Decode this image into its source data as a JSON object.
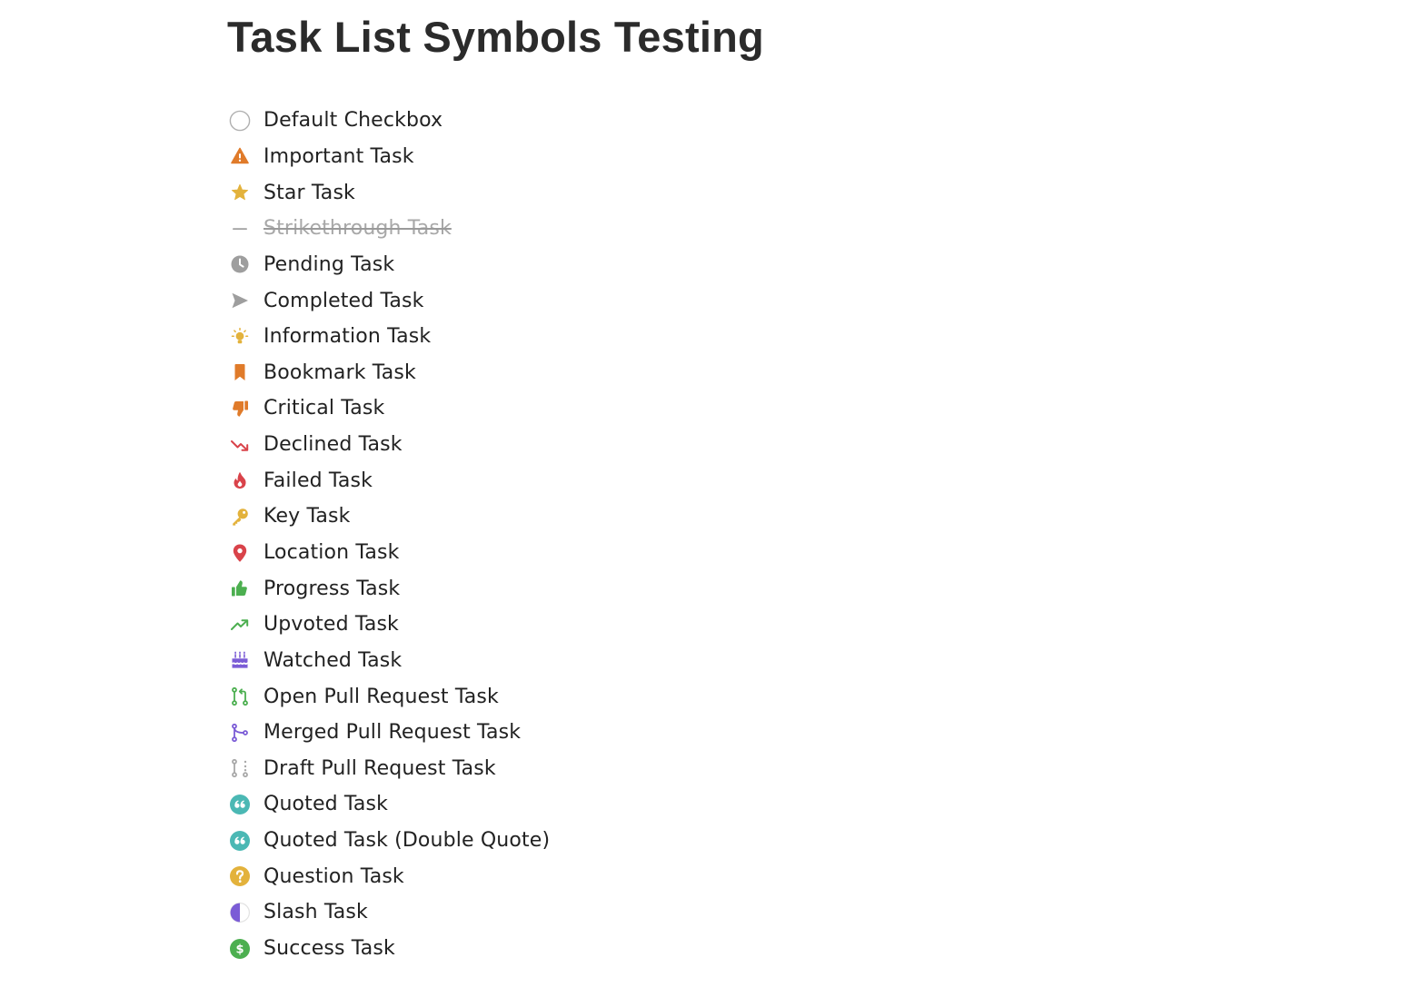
{
  "page": {
    "title": "Task List Symbols Testing"
  },
  "tasks": [
    {
      "label": "Default Checkbox",
      "icon": "empty-checkbox-icon",
      "color": "#b0b0b0"
    },
    {
      "label": "Important Task",
      "icon": "warning-triangle-icon",
      "color": "#e07b2a"
    },
    {
      "label": "Star Task",
      "icon": "star-icon",
      "color": "#e3b23c"
    },
    {
      "label": "Strikethrough Task",
      "icon": "dash-icon",
      "color": "#a0a0a0"
    },
    {
      "label": "Pending Task",
      "icon": "clock-icon",
      "color": "#9e9e9e"
    },
    {
      "label": "Completed Task",
      "icon": "paper-plane-icon",
      "color": "#9e9e9e"
    },
    {
      "label": "Information Task",
      "icon": "lightbulb-icon",
      "color": "#e3b23c"
    },
    {
      "label": "Bookmark Task",
      "icon": "bookmark-icon",
      "color": "#e07b2a"
    },
    {
      "label": "Critical Task",
      "icon": "thumbs-down-icon",
      "color": "#e07b2a"
    },
    {
      "label": "Declined Task",
      "icon": "trending-down-icon",
      "color": "#d9434a"
    },
    {
      "label": "Failed Task",
      "icon": "fire-icon",
      "color": "#d9434a"
    },
    {
      "label": "Key Task",
      "icon": "key-icon",
      "color": "#e3b23c"
    },
    {
      "label": "Location Task",
      "icon": "map-pin-icon",
      "color": "#d9434a"
    },
    {
      "label": "Progress Task",
      "icon": "thumbs-up-icon",
      "color": "#4caf50"
    },
    {
      "label": "Upvoted Task",
      "icon": "trending-up-icon",
      "color": "#4caf50"
    },
    {
      "label": "Watched Task",
      "icon": "cake-icon",
      "color": "#7b5cd6"
    },
    {
      "label": "Open Pull Request Task",
      "icon": "pull-request-icon",
      "color": "#4caf50"
    },
    {
      "label": "Merged Pull Request Task",
      "icon": "merge-icon",
      "color": "#7b5cd6"
    },
    {
      "label": "Draft Pull Request Task",
      "icon": "draft-pull-request-icon",
      "color": "#a8a8a8"
    },
    {
      "label": "Quoted Task",
      "icon": "quote-icon",
      "color": "#4bb8b4"
    },
    {
      "label": "Quoted Task (Double Quote)",
      "icon": "quote-icon",
      "color": "#4bb8b4"
    },
    {
      "label": "Question Task",
      "icon": "question-circle-icon",
      "color": "#e3b23c"
    },
    {
      "label": "Slash Task",
      "icon": "half-circle-icon",
      "color": "#7b5cd6"
    },
    {
      "label": "Success Task",
      "icon": "dollar-circle-icon",
      "color": "#4caf50"
    }
  ]
}
